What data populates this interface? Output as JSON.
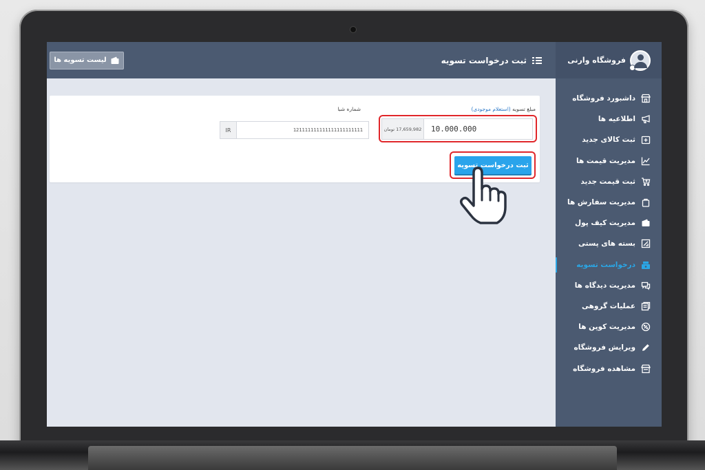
{
  "store": {
    "name": "فروشگاه وارنی"
  },
  "header": {
    "title": "ثبت درخواست تسویه",
    "list_button": "لیست تسویه ها"
  },
  "sidebar": {
    "items": [
      {
        "label": "داشبورد فروشگاه",
        "icon": "store-icon",
        "active": false
      },
      {
        "label": "اطلاعیه ها",
        "icon": "megaphone-icon",
        "active": false
      },
      {
        "label": "ثبت کالای جدید",
        "icon": "add-product-icon",
        "active": false
      },
      {
        "label": "مدیریت قیمت ها",
        "icon": "chart-line-icon",
        "active": false
      },
      {
        "label": "ثبت قیمت جدید",
        "icon": "cart-plus-icon",
        "active": false
      },
      {
        "label": "مدیریت سفارش ها",
        "icon": "shopping-bag-icon",
        "active": false
      },
      {
        "label": "مدیریت کیف پول",
        "icon": "wallet-icon",
        "active": false
      },
      {
        "label": "بسته های پستی",
        "icon": "package-icon",
        "active": false
      },
      {
        "label": "درخواست تسویه",
        "icon": "cash-register-icon",
        "active": true
      },
      {
        "label": "مدیریت دیدگاه ها",
        "icon": "comments-icon",
        "active": false
      },
      {
        "label": "عملیات گروهی",
        "icon": "bulk-operations-icon",
        "active": false
      },
      {
        "label": "مدیریت کوپن ها",
        "icon": "coupon-icon",
        "active": false
      },
      {
        "label": "ویرایش فروشگاه",
        "icon": "pencil-icon",
        "active": false
      },
      {
        "label": "مشاهده فروشگاه",
        "icon": "storefront-icon",
        "active": false
      }
    ]
  },
  "form": {
    "amount_label": "مبلغ تسویه",
    "amount_link": "(استعلام موجودی)",
    "amount_value": "10.000.000",
    "amount_balance": "17,659,982 تومان",
    "iban_label": "شماره شبا",
    "iban_prefix": "IR",
    "iban_value": "121111111111111111111111",
    "submit_label": "ثبت درخواست تسویه"
  },
  "colors": {
    "accent": "#2aa6e6",
    "sidebar": "#4b5a71",
    "highlight": "#e0262a"
  }
}
